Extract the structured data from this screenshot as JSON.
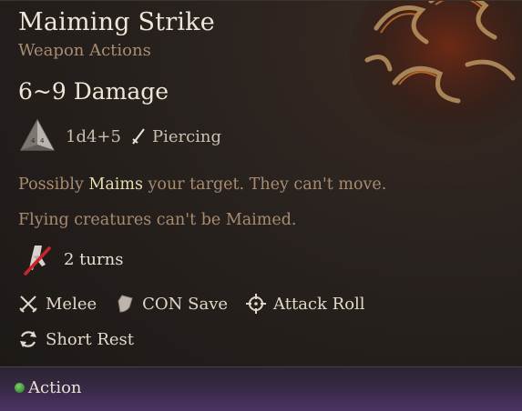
{
  "spell": {
    "name": "Maiming Strike",
    "category": "Weapon Actions",
    "damage": "6~9 Damage",
    "dice": "1d4+5",
    "damage_type": "Piercing"
  },
  "description": {
    "line1_prefix": "Possibly ",
    "line1_keyword": "Maims",
    "line1_suffix": " your target. They can't move.",
    "line2": "Flying creatures can't be Maimed."
  },
  "duration": {
    "text": "2 turns"
  },
  "properties": {
    "melee": "Melee",
    "save": "CON Save",
    "attack": "Attack Roll",
    "rest": "Short Rest"
  },
  "footer": {
    "cost": "Action"
  },
  "colors": {
    "title": "#f0e6d8",
    "subtitle": "#a98c6f",
    "keyword": "#e6dcae",
    "action_dot": "#3c8d35",
    "footer_bg": "#4a3363"
  }
}
